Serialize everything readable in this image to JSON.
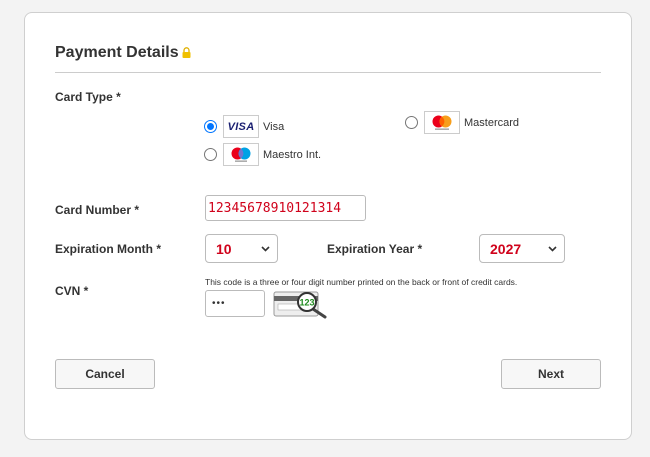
{
  "form": {
    "title": "Payment Details",
    "lock_icon": "lock-icon"
  },
  "card_type": {
    "label": "Card Type *",
    "options": [
      {
        "label": "Visa",
        "checked": true,
        "logo": "visa-logo",
        "logo_text": "VISA"
      },
      {
        "label": "Mastercard",
        "checked": false,
        "logo": "mastercard-logo"
      },
      {
        "label": "Maestro Int.",
        "checked": false,
        "logo": "maestro-logo"
      }
    ]
  },
  "card_number": {
    "label": "Card Number *",
    "value": "12345678910121314"
  },
  "expiration_month": {
    "label": "Expiration Month *",
    "value": "10"
  },
  "expiration_year": {
    "label": "Expiration Year *",
    "value": "2027"
  },
  "cvn": {
    "label": "CVN *",
    "help": "This code is a three or four digit number printed on the back or front of credit cards.",
    "value": "•••",
    "image_digits": "123"
  },
  "actions": {
    "cancel": "Cancel",
    "next": "Next"
  },
  "colors": {
    "accent": "#0075ff",
    "value_red": "#d0021b",
    "lock_yellow": "#f0c000"
  }
}
